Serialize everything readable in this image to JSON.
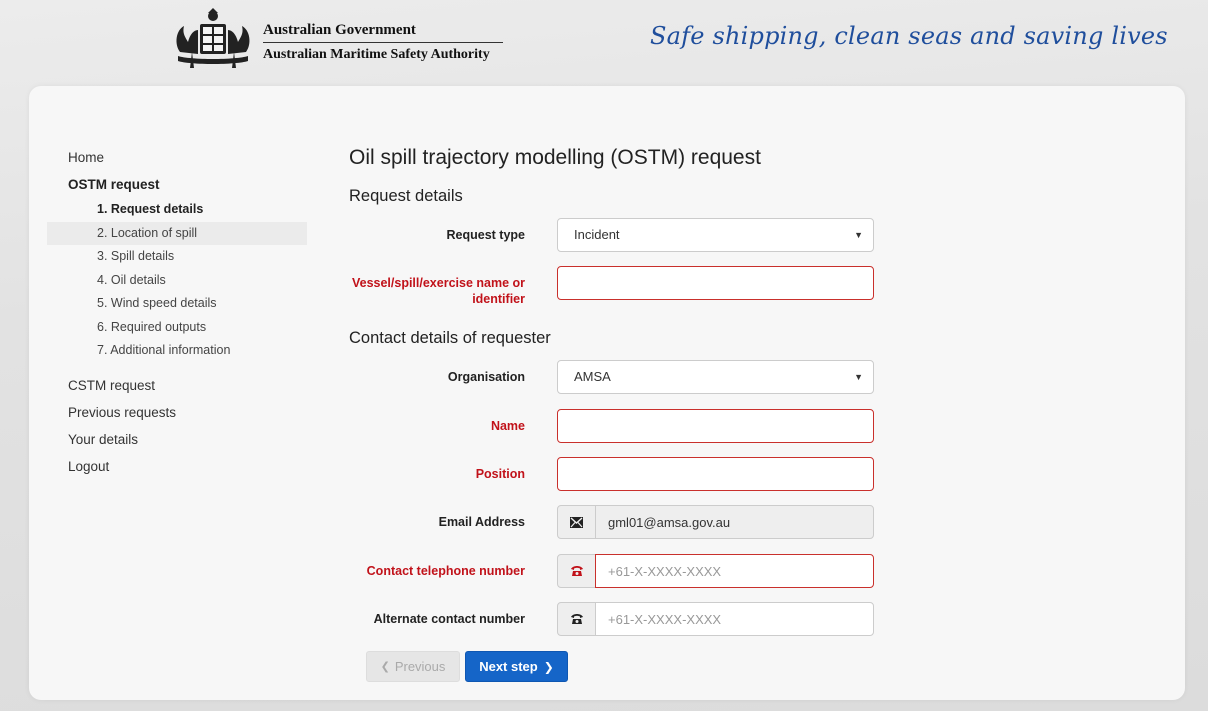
{
  "header": {
    "gov_title": "Australian Government",
    "gov_subtitle": "Australian Maritime Safety Authority",
    "tagline": "Safe shipping, clean seas and saving lives"
  },
  "sidebar": {
    "home": "Home",
    "ostm": "OSTM request",
    "steps": [
      "1. Request details",
      "2. Location of spill",
      "3. Spill details",
      "4. Oil details",
      "5. Wind speed details",
      "6. Required outputs",
      "7. Additional information"
    ],
    "cstm": "CSTM request",
    "previous": "Previous requests",
    "your_details": "Your details",
    "logout": "Logout"
  },
  "main": {
    "title": "Oil spill trajectory modelling (OSTM) request",
    "section_request": "Request details",
    "section_contact": "Contact details of requester"
  },
  "form": {
    "request_type": {
      "label": "Request type",
      "value": "Incident"
    },
    "vessel_name": {
      "label": "Vessel/spill/exercise name or identifier",
      "value": ""
    },
    "organisation": {
      "label": "Organisation",
      "value": "AMSA"
    },
    "name": {
      "label": "Name",
      "value": ""
    },
    "position": {
      "label": "Position",
      "value": ""
    },
    "email": {
      "label": "Email Address",
      "value": "gml01@amsa.gov.au"
    },
    "contact_phone": {
      "label": "Contact telephone number",
      "placeholder": "+61-X-XXXX-XXXX"
    },
    "alt_phone": {
      "label": "Alternate contact number",
      "placeholder": "+61-X-XXXX-XXXX"
    }
  },
  "buttons": {
    "previous": "Previous",
    "next": "Next step"
  },
  "colors": {
    "primary": "#1565c8",
    "required": "#c1121a",
    "tagline": "#1f4e9c"
  },
  "icons": {
    "email": "envelope-icon",
    "phone": "telephone-icon",
    "prev": "chevron-left-icon",
    "next": "chevron-right-icon",
    "select": "caret-down-icon"
  }
}
